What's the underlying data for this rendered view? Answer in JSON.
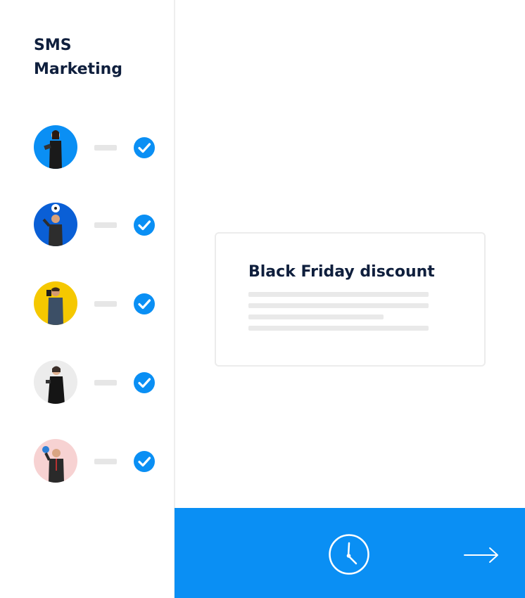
{
  "sidebar": {
    "title": "SMS Marketing",
    "contacts": [
      {
        "avatar_bg": "#0a8ff4",
        "status": "check-icon"
      },
      {
        "avatar_bg": "#0a5fd6",
        "status": "check-icon"
      },
      {
        "avatar_bg": "#f5c800",
        "status": "check-icon"
      },
      {
        "avatar_bg": "#ececec",
        "status": "check-icon"
      },
      {
        "avatar_bg": "#f7d2d2",
        "status": "check-icon"
      }
    ]
  },
  "card": {
    "title": "Black Friday discount"
  },
  "bottom_bar": {
    "color": "#0a8ff4",
    "icons": [
      "clock-icon",
      "arrow-right-icon"
    ]
  },
  "colors": {
    "accent": "#0a8ff4",
    "title": "#0f1f3d"
  }
}
